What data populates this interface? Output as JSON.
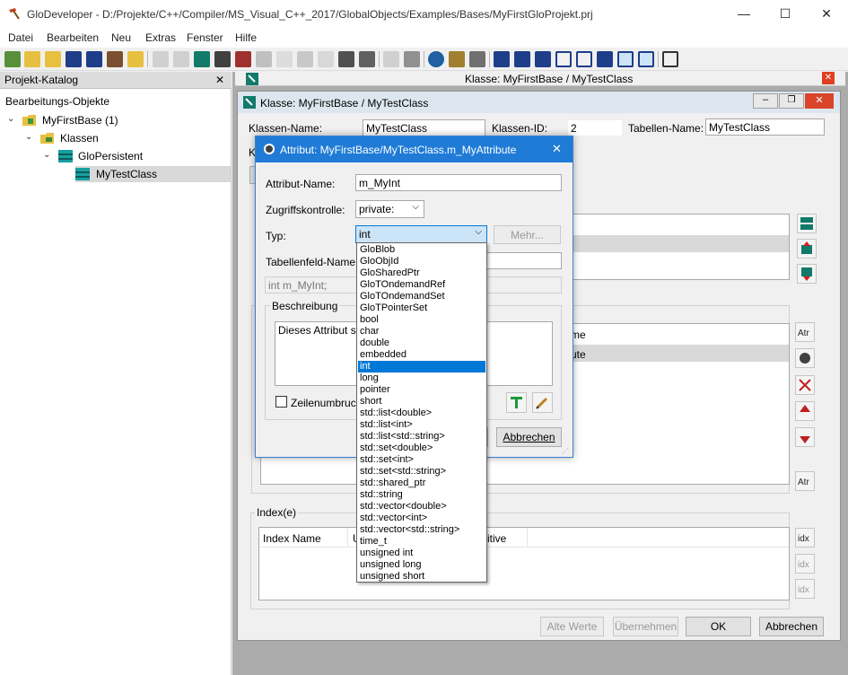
{
  "window": {
    "title": "GloDeveloper - D:/Projekte/C++/Compiler/MS_Visual_C++_2017/GlobalObjects/Examples/Bases/MyFirstGloProjekt.prj",
    "minimize": "—",
    "maximize": "☐",
    "close": "✕"
  },
  "menu": [
    "Datei",
    "Bearbeiten",
    "Neu",
    "Extras",
    "Fenster",
    "Hilfe"
  ],
  "left_panel": {
    "title": "Projekt-Katalog",
    "close": "✕",
    "root_label": "Bearbeitungs-Objekte",
    "tree": [
      {
        "label": "MyFirstBase (1)",
        "toggle": "⌄"
      },
      {
        "label": "Klassen",
        "toggle": "⌄"
      },
      {
        "label": "GloPersistent",
        "toggle": "⌄"
      },
      {
        "label": "MyTestClass",
        "toggle": ""
      }
    ]
  },
  "mdi": {
    "title": "Klasse: MyFirstBase / MyTestClass",
    "close": "✕"
  },
  "class_dialog": {
    "title": "Klasse: MyFirstBase / MyTestClass",
    "class_name_label": "Klassen-Name:",
    "class_name_value": "MyTestClass",
    "class_id_label": "Klassen-ID:",
    "class_id_value": "2",
    "table_name_label": "Tabellen-Name:",
    "table_name_value": "MyTestClass",
    "frag_k": "K",
    "frag_me": "me",
    "frag_ute": "ute",
    "index_group": "Index(e)",
    "index_col1": "Index Name",
    "index_col2": "U",
    "index_col3": "itive",
    "btn_alte_werte": "Alte Werte",
    "btn_uebernehmen": "Übernehmen",
    "btn_ok": "OK",
    "btn_abbrechen": "Abbrechen"
  },
  "attr_dialog": {
    "title": "Attribut: MyFirstBase/MyTestClass.m_MyAttribute",
    "close": "✕",
    "name_label": "Attribut-Name:",
    "name_value": "m_MyInt",
    "access_label": "Zugriffskontrolle:",
    "access_value": "private:",
    "type_label": "Typ:",
    "type_value": "int",
    "more_button": "Mehr...",
    "column_label": "Tabellenfeld-Name:",
    "column_value": "",
    "preview": "int m_MyInt;",
    "desc_group": "Beschreibung",
    "desc_text": "Dieses Attribut so",
    "wrap_label": "Zeilenumbruch",
    "cancel": "Abbrechen"
  },
  "type_options": [
    "GloBlob",
    "GloObjId",
    "GloSharedPtr",
    "GloTOndemandRef",
    "GloTOndemandSet",
    "GloTPointerSet",
    "bool",
    "char",
    "double",
    "embedded",
    "int",
    "long",
    "pointer",
    "short",
    "std::list<double>",
    "std::list<int>",
    "std::list<std::string>",
    "std::set<double>",
    "std::set<int>",
    "std::set<std::string>",
    "std::shared_ptr",
    "std::string",
    "std::vector<double>",
    "std::vector<int>",
    "std::vector<std::string>",
    "time_t",
    "unsigned int",
    "unsigned long",
    "unsigned short"
  ],
  "selected_type_index": 10,
  "colors": {
    "accent": "#0078d7",
    "mdi_background": "#ababab"
  }
}
